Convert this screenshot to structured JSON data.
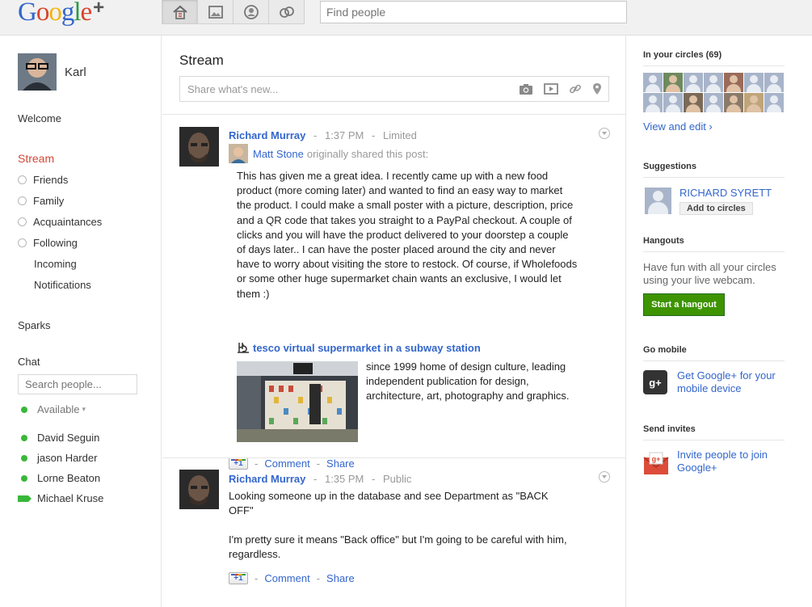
{
  "header": {
    "logo_text": "Google+",
    "search_placeholder": "Find people",
    "tabs": [
      "home-icon",
      "photos-icon",
      "profile-icon",
      "circles-icon"
    ]
  },
  "left": {
    "profile_name": "Karl",
    "welcome": "Welcome",
    "stream": "Stream",
    "circles": [
      "Friends",
      "Family",
      "Acquaintances",
      "Following"
    ],
    "sub_items": [
      "Incoming",
      "Notifications"
    ],
    "sparks": "Sparks",
    "chat_label": "Chat",
    "chat_search_placeholder": "Search people...",
    "status": "Available",
    "contacts": [
      "David Seguin",
      "jason Harder",
      "Lorne Beaton",
      "Michael Kruse"
    ]
  },
  "stream": {
    "title": "Stream",
    "share_placeholder": "Share what's new...",
    "posts": [
      {
        "author": "Richard Murray",
        "time": "1:37 PM",
        "visibility": "Limited",
        "reshared_from": "Matt Stone",
        "reshare_text": "originally shared this post:",
        "body": "This has given me a great idea. I recently came up with a new food product (more coming later) and wanted to find an easy way to market the product. I could make a small poster with a picture, description, price and a QR code that takes you straight to a PayPal checkout. A couple of clicks and you will have the product delivered to your doorstep a couple of days later.. I can have the poster placed around the city and never have to worry about visiting the store to restock. Of course, if Wholefoods or some other huge supermarket chain wants an exclusive, I would let them :)",
        "link_title": "tesco virtual supermarket in a subway station",
        "link_desc": "since 1999 home of design culture, leading independent publication for design, architecture, art, photography and graphics."
      },
      {
        "author": "Richard Murray",
        "time": "1:35 PM",
        "visibility": "Public",
        "body1": "Looking someone up in the database and see Department as \"BACK OFF\"",
        "body2": "I'm pretty sure it means \"Back office\" but I'm going to be careful with him, regardless."
      }
    ],
    "actions": {
      "plusone": "+1",
      "comment": "Comment",
      "share": "Share",
      "dash": "-"
    }
  },
  "right": {
    "circles_heading": "In your circles (69)",
    "view_edit": "View and edit ›",
    "suggestions_heading": "Suggestions",
    "suggestion_name": "RICHARD SYRETT",
    "add_to_circles": "Add to circles",
    "hangouts_heading": "Hangouts",
    "hangouts_text": "Have fun with all your circles using your live webcam.",
    "start_hangout": "Start a hangout",
    "mobile_heading": "Go mobile",
    "mobile_text": "Get Google+ for your mobile device",
    "invites_heading": "Send invites",
    "invites_text": "Invite people to join Google+",
    "mobile_icon_text": "g+"
  }
}
